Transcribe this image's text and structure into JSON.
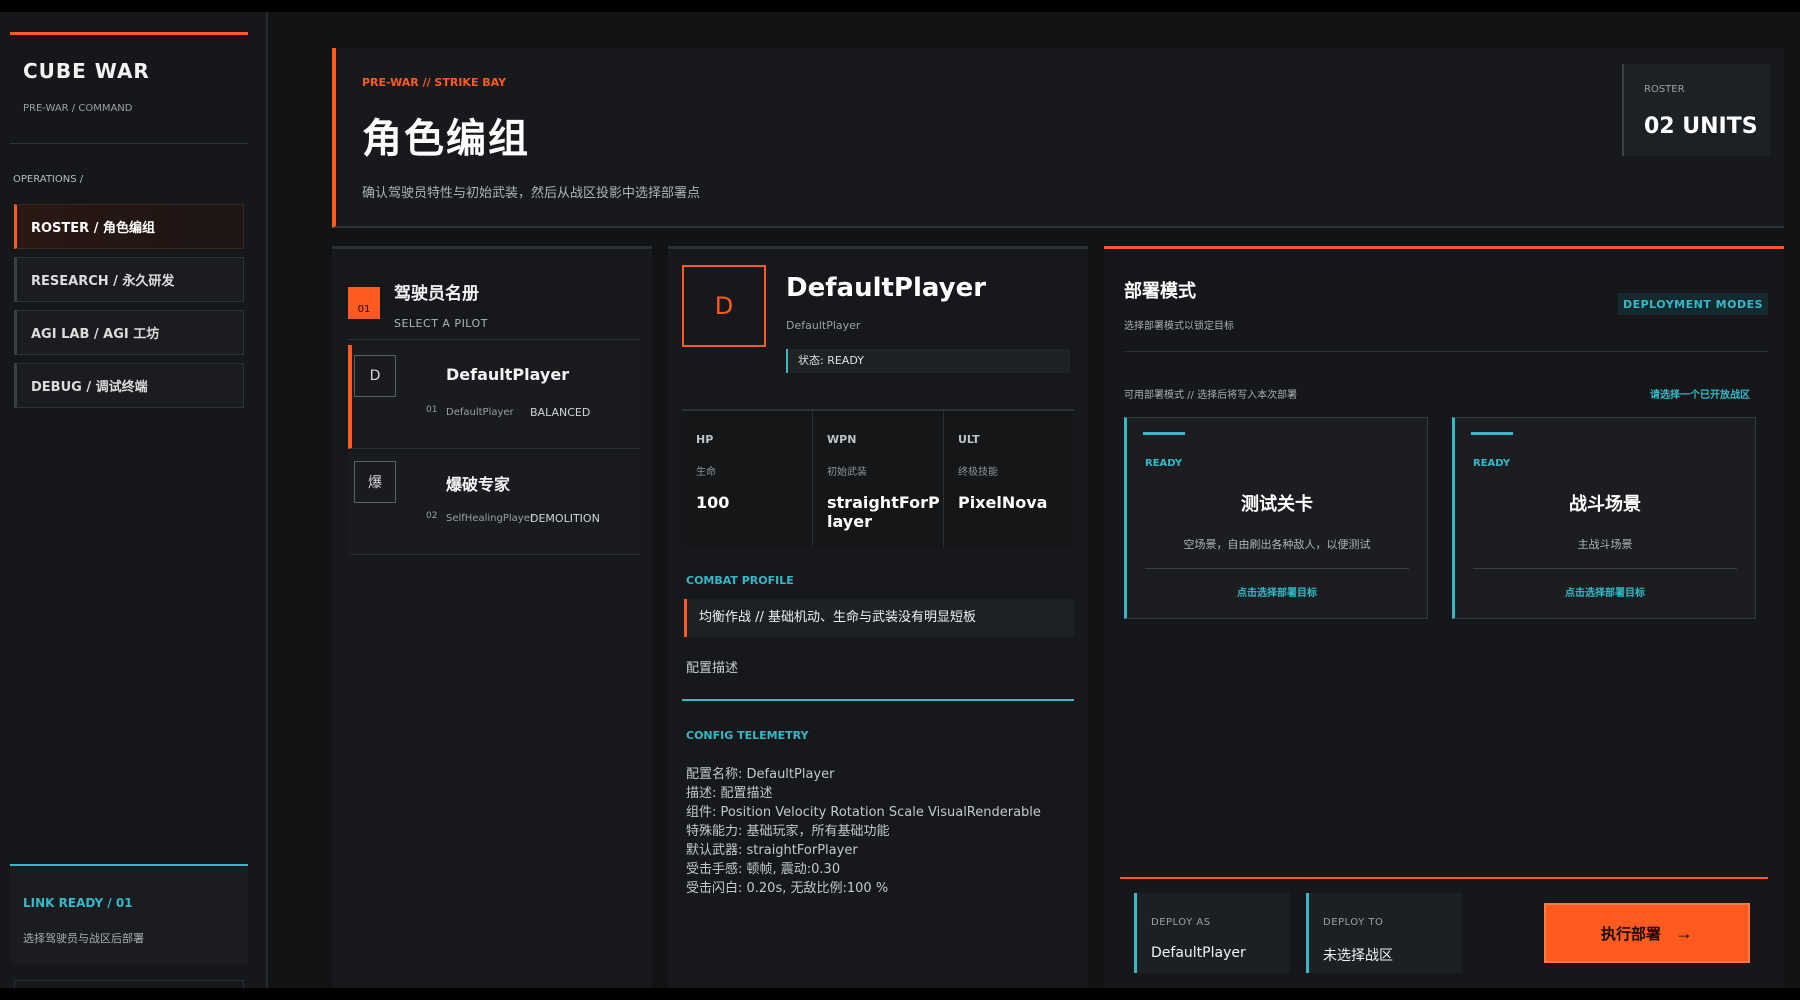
{
  "sidebar": {
    "brand_title": "CUBE WAR",
    "brand_sub": "PRE-WAR / COMMAND",
    "ops_label": "OPERATIONS /",
    "items": [
      {
        "label": "ROSTER  /  角色编组"
      },
      {
        "label": "RESEARCH  /  永久研发"
      },
      {
        "label": "AGI LAB  /  AGI 工坊"
      },
      {
        "label": "DEBUG  /  调试终端"
      }
    ],
    "link_title": "LINK READY / 01",
    "link_sub": "选择驾驶员与战区后部署"
  },
  "header": {
    "kicker": "PRE-WAR // STRIKE BAY",
    "title": "角色编组",
    "desc": "确认驾驶员特性与初始武装，然后从战区投影中选择部署点",
    "roster_label": "ROSTER",
    "roster_value": "02 UNITS"
  },
  "pilots": {
    "badge": "01",
    "title": "驾驶员名册",
    "subtitle": "SELECT A PILOT",
    "rows": [
      {
        "avatar": "D",
        "name": "DefaultPlayer",
        "index": "01",
        "cls": "DefaultPlayer",
        "role": "BALANCED"
      },
      {
        "avatar": "爆",
        "name": "爆破专家",
        "index": "02",
        "cls": "SelfHealingPlayer",
        "role": "DEMOLITION"
      }
    ]
  },
  "details": {
    "avatar": "D",
    "name": "DefaultPlayer",
    "cls": "DefaultPlayer",
    "status": "状态: READY",
    "stats": [
      {
        "key": "HP",
        "key_zh": "生命",
        "value": "100"
      },
      {
        "key": "WPN",
        "key_zh": "初始武装",
        "value": "straightForPlayer"
      },
      {
        "key": "ULT",
        "key_zh": "终极技能",
        "value": "PixelNova"
      }
    ],
    "combat_label": "COMBAT PROFILE",
    "combat_text": "均衡作战 // 基础机动、生命与武装没有明显短板",
    "config_desc": "配置描述",
    "telemetry_label": "CONFIG TELEMETRY",
    "telemetry": [
      "配置名称: DefaultPlayer",
      "描述: 配置描述",
      "组件: Position Velocity Rotation Scale VisualRenderable",
      "特殊能力: 基础玩家，所有基础功能",
      "默认武器: straightForPlayer",
      "受击手感: 顿帧, 震动:0.30",
      "受击闪白: 0.20s, 无敌比例:100 %"
    ]
  },
  "deploy": {
    "title": "部署模式",
    "subtitle": "选择部署模式以锁定目标",
    "badge": "DEPLOYMENT MODES",
    "avail": "可用部署模式 // 选择后将写入本次部署",
    "hint": "请选择一个已开放战区",
    "modes": [
      {
        "ready": "READY",
        "name": "测试关卡",
        "desc": "空场景，自由刷出各种敌人，以便测试",
        "cta": "点击选择部署目标"
      },
      {
        "ready": "READY",
        "name": "战斗场景",
        "desc": "主战斗场景",
        "cta": "点击选择部署目标"
      }
    ],
    "deploy_as_label": "DEPLOY AS",
    "deploy_as_value": "DefaultPlayer",
    "deploy_to_label": "DEPLOY TO",
    "deploy_to_value": "未选择战区",
    "exec_label": "执行部署",
    "exec_arrow": "→"
  },
  "colors": {
    "accent": "#ff5a1f",
    "cyan": "#35b9c9",
    "background": "#111315"
  }
}
